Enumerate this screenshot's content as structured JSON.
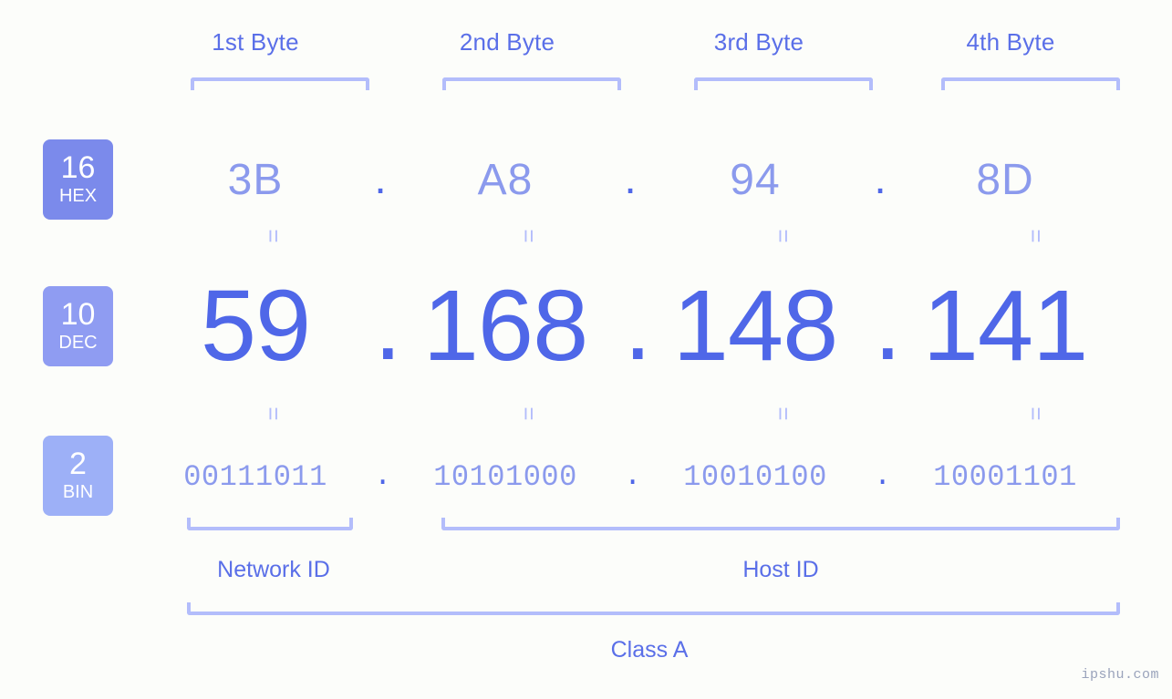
{
  "background_color": "#fcfdfa",
  "accent_colors": {
    "strong_blue": "#4f67e8",
    "mid_blue": "#5a6fe8",
    "light_blue": "#8b9aed",
    "bracket_blue": "#b3bdfb",
    "badge_hex": "#7b8aeb",
    "badge_dec": "#8f9cf2",
    "badge_bin": "#9db0f7"
  },
  "byte_headers": [
    {
      "label": "1st Byte"
    },
    {
      "label": "2nd Byte"
    },
    {
      "label": "3rd Byte"
    },
    {
      "label": "4th Byte"
    }
  ],
  "base_badges": [
    {
      "number": "16",
      "abbr": "HEX"
    },
    {
      "number": "10",
      "abbr": "DEC"
    },
    {
      "number": "2",
      "abbr": "BIN"
    }
  ],
  "separators": {
    "dot": ".",
    "equals": "="
  },
  "rows": {
    "hex": {
      "octets": [
        "3B",
        "A8",
        "94",
        "8D"
      ]
    },
    "dec": {
      "octets": [
        "59",
        "168",
        "148",
        "141"
      ]
    },
    "bin": {
      "octets": [
        "00111011",
        "10101000",
        "10010100",
        "10001101"
      ]
    }
  },
  "sections": {
    "network_id": "Network ID",
    "host_id": "Host ID",
    "class": "Class A"
  },
  "watermark": "ipshu.com",
  "chart_data": {
    "type": "table",
    "title": "IP address 59.168.148.141 byte breakdown",
    "categories": [
      "1st Byte",
      "2nd Byte",
      "3rd Byte",
      "4th Byte"
    ],
    "series": [
      {
        "name": "HEX",
        "values": [
          "3B",
          "A8",
          "94",
          "8D"
        ]
      },
      {
        "name": "DEC",
        "values": [
          59,
          168,
          148,
          141
        ]
      },
      {
        "name": "BIN",
        "values": [
          "00111011",
          "10101000",
          "10010100",
          "10001101"
        ]
      }
    ],
    "annotations": {
      "network_id_bytes": 1,
      "host_id_bytes": 3,
      "address_class": "Class A"
    }
  }
}
